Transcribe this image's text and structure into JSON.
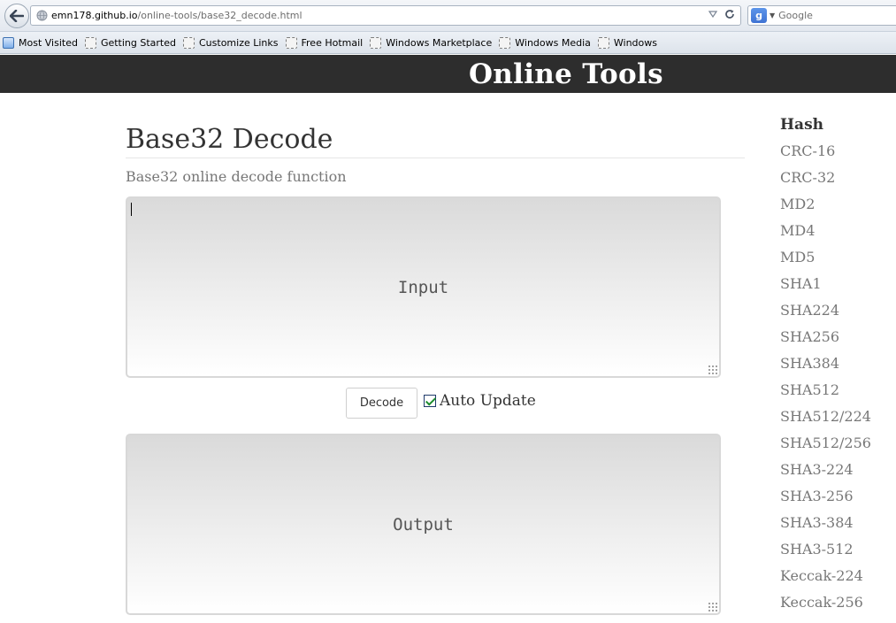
{
  "browser": {
    "url_host": "emn178.github.io",
    "url_path": "/online-tools/base32_decode.html",
    "search_placeholder": "Google",
    "bookmarks": [
      "Most Visited",
      "Getting Started",
      "Customize Links",
      "Free Hotmail",
      "Windows Marketplace",
      "Windows Media",
      "Windows"
    ]
  },
  "site": {
    "title": "Online Tools"
  },
  "main": {
    "heading": "Base32 Decode",
    "description": "Base32 online decode function",
    "input_placeholder": "Input",
    "output_placeholder": "Output",
    "decode_label": "Decode",
    "auto_update_label": "Auto Update",
    "auto_update_checked": true
  },
  "sidebar": {
    "heading": "Hash",
    "items": [
      "CRC-16",
      "CRC-32",
      "MD2",
      "MD4",
      "MD5",
      "SHA1",
      "SHA224",
      "SHA256",
      "SHA384",
      "SHA512",
      "SHA512/224",
      "SHA512/256",
      "SHA3-224",
      "SHA3-256",
      "SHA3-384",
      "SHA3-512",
      "Keccak-224",
      "Keccak-256"
    ]
  },
  "colors": {
    "header_bg": "#2d2d2d",
    "link": "#777777",
    "heading": "#333333"
  }
}
